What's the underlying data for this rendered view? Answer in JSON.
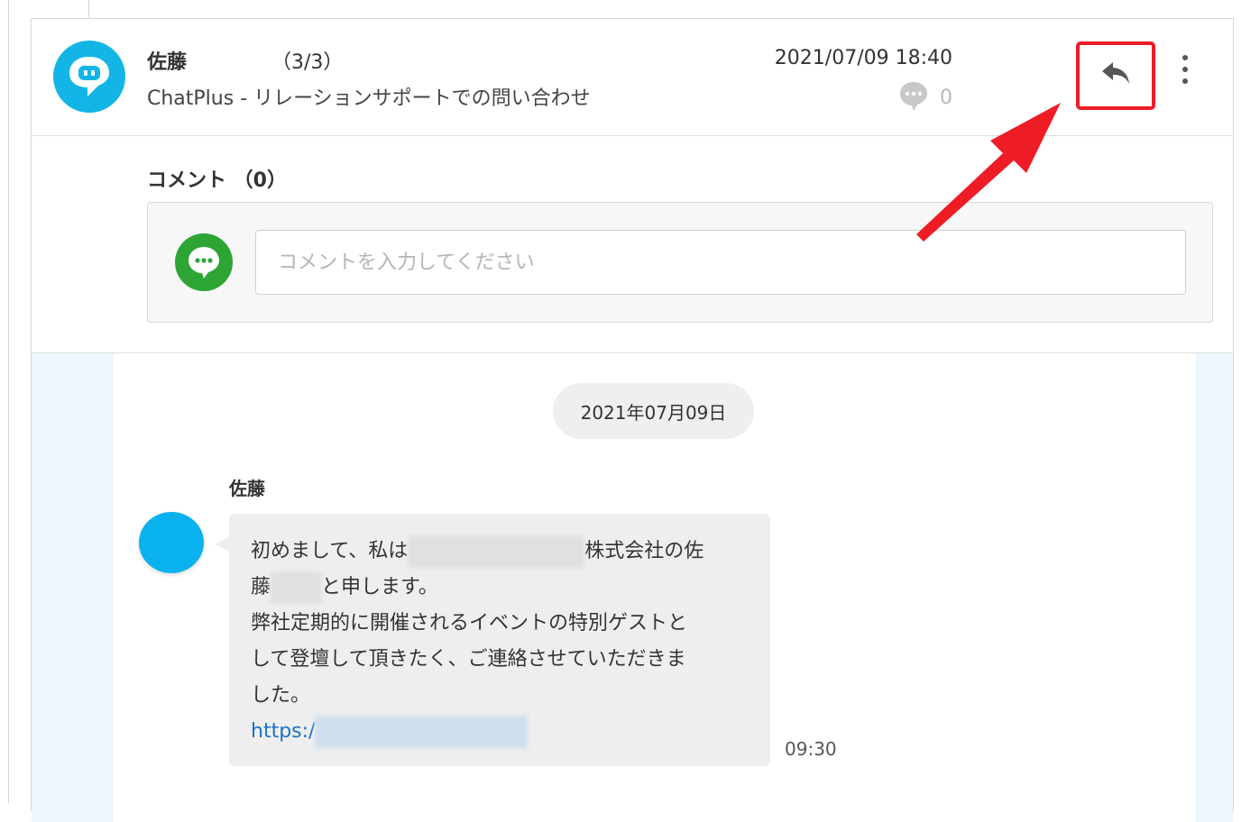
{
  "header": {
    "sender": "佐藤",
    "count": "（3/3）",
    "subject": "ChatPlus  - リレーションサポートでの問い合わせ",
    "datetime": "2021/07/09 18:40",
    "comment_count": "0",
    "icons": [
      "chatplus-logo-icon",
      "comment-bubble-icon",
      "reply-icon",
      "more-vertical-icon"
    ]
  },
  "comment": {
    "title": "コメント （0）",
    "placeholder": "コメントを入力してください",
    "avatar_icon": "chat-ellipsis-icon"
  },
  "chat": {
    "date": "2021年07月09日",
    "message": {
      "sender": "佐藤",
      "line1_a": "初めまして、私は",
      "line1_b": "株式会社の佐",
      "line2_a": "藤",
      "line2_b": "と申します。",
      "line3": "弊社定期的に開催されるイベントの特別ゲストと",
      "line4": "して登壇して頂きたく、ご連絡させていただきま",
      "line5": "した。",
      "link": "https:/",
      "time": "09:30"
    }
  },
  "annotation": {
    "highlight_color": "#ee1c24"
  },
  "colors": {
    "logo": "#12b5e6",
    "comment_avatar": "#2ca534",
    "user_avatar": "#09b1ef",
    "chat_bg": "#eef6fd"
  }
}
